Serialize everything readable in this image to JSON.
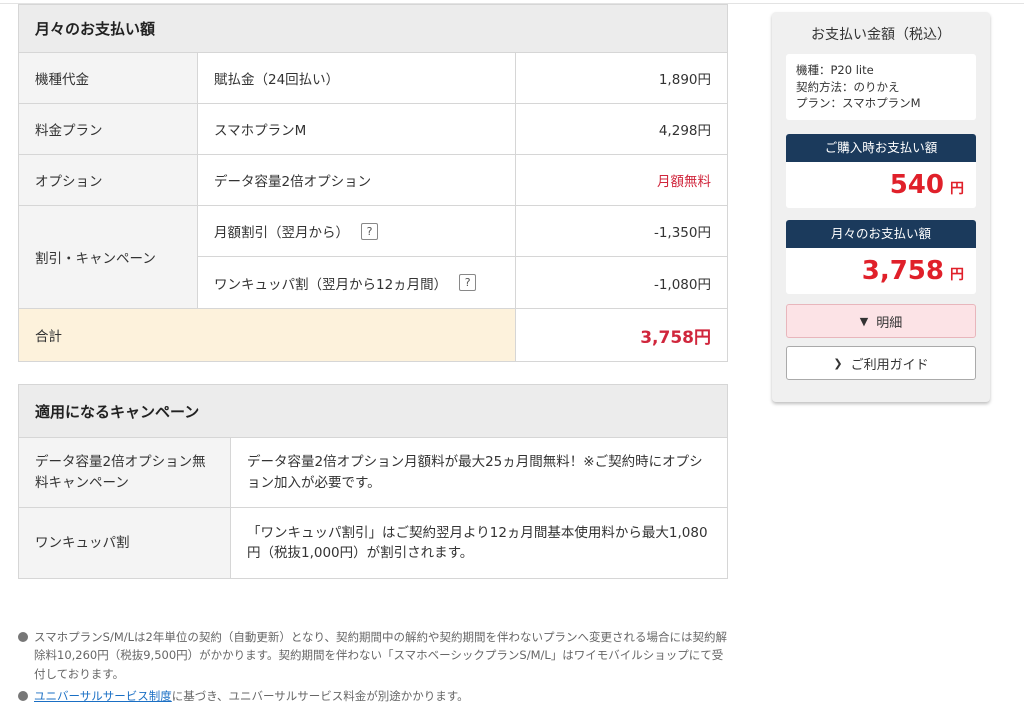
{
  "monthly": {
    "heading": "月々のお支払い額",
    "device": {
      "label": "機種代金",
      "desc": "賦払金（24回払い）",
      "value": "1,890円"
    },
    "plan": {
      "label": "料金プラン",
      "desc": "スマホプランM",
      "value": "4,298円"
    },
    "option": {
      "label": "オプション",
      "desc": "データ容量2倍オプション",
      "value": "月額無料"
    },
    "discount": {
      "label": "割引・キャンペーン",
      "items": [
        {
          "desc": "月額割引（翌月から）",
          "help": "?",
          "value": "-1,350円"
        },
        {
          "desc": "ワンキュッパ割（翌月から12ヵ月間）",
          "help": "?",
          "value": "-1,080円"
        }
      ]
    },
    "total": {
      "label": "合計",
      "value": "3,758円"
    }
  },
  "campaigns": {
    "heading": "適用になるキャンペーン",
    "rows": [
      {
        "label": "データ容量2倍オプション無料キャンペーン",
        "desc": "データ容量2倍オプション月額料が最大25ヵ月間無料！※ご契約時にオプション加入が必要です。"
      },
      {
        "label": "ワンキュッパ割",
        "desc": "「ワンキュッパ割引」はご契約翌月より12ヵ月間基本使用料から最大1,080円（税抜1,000円）が割引されます。"
      }
    ]
  },
  "notes": {
    "note1": "スマホプランS/M/Lは2年単位の契約（自動更新）となり、契約期間中の解約や契約期間を伴わないプランへ変更される場合には契約解除料10,260円（税抜9,500円）がかかります。契約期間を伴わない「スマホベーシックプランS/M/L」はワイモバイルショップにて受付しております。",
    "note2_link": "ユニバーサルサービス制度",
    "note2_rest": "に基づき、ユニバーサルサービス料金が別途かかります。"
  },
  "sidebar": {
    "title": "お支払い金額（税込）",
    "info": {
      "model": "機種：P20 lite",
      "method": "契約方法：のりかえ",
      "plan": "プラン：スマホプランM"
    },
    "purchase": {
      "label": "ご購入時お支払い額",
      "amount": "540",
      "unit": "円"
    },
    "monthly": {
      "label": "月々のお支払い額",
      "amount": "3,758",
      "unit": "円"
    },
    "detail_button": "明細",
    "guide_button": "ご利用ガイド"
  },
  "colors": {
    "navy": "#1b3a5c",
    "red": "#e0202a",
    "total_bg": "#fdf2dc",
    "detail_bg": "#fce3e6"
  },
  "icons": {
    "detail": "chevron-down-icon",
    "guide": "chevron-right-icon",
    "note": "bullet-icon"
  }
}
